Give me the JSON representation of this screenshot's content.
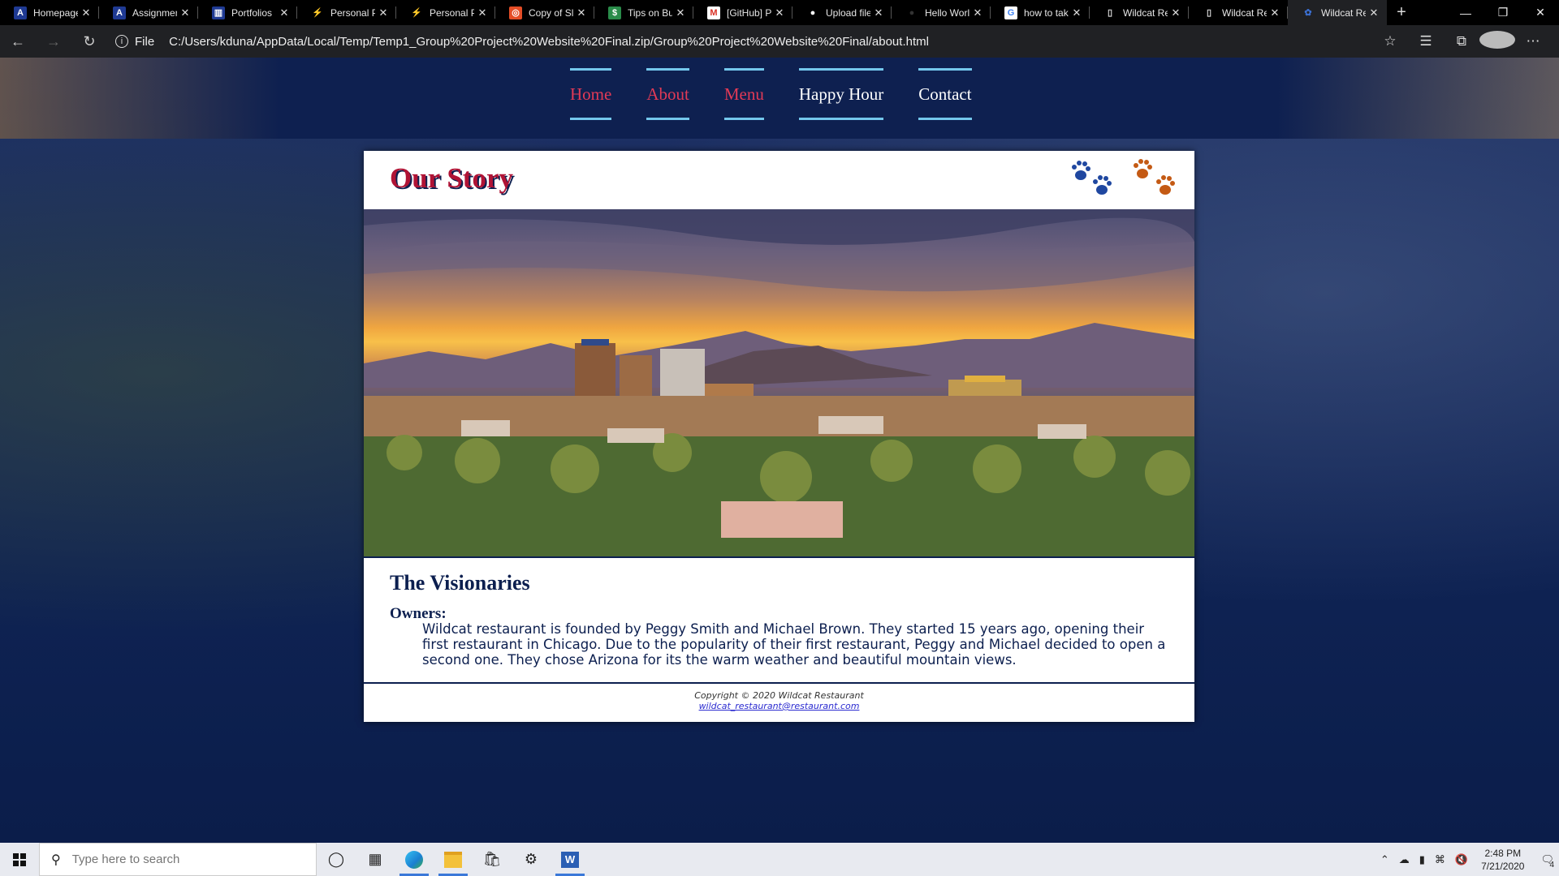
{
  "browser": {
    "tabs": [
      {
        "label": "Homepage",
        "icon": "arizona-a-icon",
        "active": false
      },
      {
        "label": "Assignments",
        "icon": "arizona-a-icon",
        "active": false
      },
      {
        "label": "Portfolios",
        "icon": "arizona-building-icon",
        "active": false
      },
      {
        "label": "Personal Portfolio",
        "icon": "lightning-icon",
        "active": false
      },
      {
        "label": "Personal Portfolio",
        "icon": "lightning-icon",
        "active": false
      },
      {
        "label": "Copy of Slides",
        "icon": "copy-icon",
        "active": false
      },
      {
        "label": "Tips on Building",
        "icon": "dollar-icon",
        "active": false
      },
      {
        "label": "[GitHub] Please verify",
        "icon": "gmail-icon",
        "active": false
      },
      {
        "label": "Upload files",
        "icon": "github-icon",
        "active": false
      },
      {
        "label": "Hello World",
        "icon": "github-dark-icon",
        "active": false
      },
      {
        "label": "how to take",
        "icon": "google-icon",
        "active": false
      },
      {
        "label": "Wildcat Restaurant",
        "icon": "file-icon",
        "active": false
      },
      {
        "label": "Wildcat Restaurant",
        "icon": "file-icon",
        "active": false
      },
      {
        "label": "Wildcat Restaurant",
        "icon": "paw-icon",
        "active": true
      }
    ],
    "address": {
      "scheme": "File",
      "url": "C:/Users/kduna/AppData/Local/Temp/Temp1_Group%20Project%20Website%20Final.zip/Group%20Project%20Website%20Final/about.html"
    }
  },
  "site": {
    "nav": [
      {
        "label": "Home",
        "color": "#e23a56"
      },
      {
        "label": "About",
        "color": "#e23a56"
      },
      {
        "label": "Menu",
        "color": "#e23a56"
      },
      {
        "label": "Happy Hour",
        "color": "#ffffff"
      },
      {
        "label": "Contact",
        "color": "#ffffff"
      }
    ],
    "title": "Our Story",
    "section_heading": "The Visionaries",
    "owners_label": "Owners:",
    "owners_text": "Wildcat restaurant is founded by Peggy Smith and Michael Brown. They started 15 years ago, opening their first restaurant in Chicago. Due to the popularity of their first restaurant, Peggy and Michael decided to open a second one. They chose Arizona for its the warm weather and beautiful mountain views.",
    "footer_copyright": "Copyright © 2020 Wildcat Restaurant",
    "footer_email": "wildcat_restaurant@restaurant.com",
    "colors": {
      "brand_red": "#b01335",
      "navy": "#0c1f4f",
      "accent_blue": "#74c7ec"
    }
  },
  "taskbar": {
    "search_placeholder": "Type here to search",
    "time": "2:48 PM",
    "date": "7/21/2020",
    "notification_count": "4"
  }
}
